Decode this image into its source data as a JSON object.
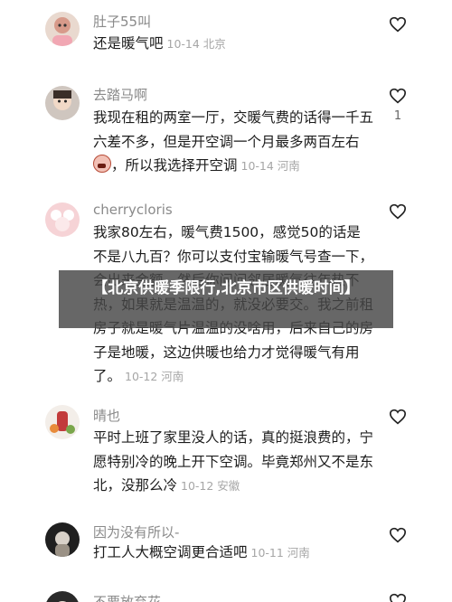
{
  "comments": [
    {
      "username": "肚子55叫",
      "text": "还是暖气吧",
      "meta": "10-14 北京",
      "icon": "heart-outline-icon",
      "likes": ""
    },
    {
      "username": "去踏马啊",
      "text": "我现在租的两室一厅，交暖气费的话得一千五六差不多，但是开空调一个月最多两百左右",
      "text2": "，所以我选择开空调",
      "meta": "10-14 河南",
      "icon": "heart-outline-icon",
      "likes": "1"
    },
    {
      "username": "cherrycloris",
      "text": "我家80左右，暖气费1500，感觉50的话是不是八九百？你可以支付宝输暖气号查一下，会出来金额，然后你问问邻居暖气往年热不热，如果就是温温的，就没必要交。我之前租房子就是暖气片温温的没啥用，后来自己的房子是地暖，这边供暖也给力才觉得暖气有用了。",
      "meta": "10-12 河南",
      "icon": "heart-outline-icon",
      "likes": ""
    },
    {
      "username": "晴也",
      "text": "平时上班了家里没人的话，真的挺浪费的，宁愿特别冷的晚上开下空调。毕竟郑州又不是东北，没那么冷",
      "meta": "10-12 安徽",
      "icon": "heart-outline-icon",
      "likes": ""
    },
    {
      "username": "因为没有所以-",
      "text": "打工人大概空调更合适吧",
      "meta": "10-11 河南",
      "icon": "heart-outline-icon",
      "likes": ""
    },
    {
      "username": "不要放弃花",
      "text": "",
      "meta": "",
      "icon": "heart-outline-icon",
      "likes": ""
    }
  ],
  "banner": {
    "text": "【北京供暖季限行,北京市区供暖时间】"
  }
}
